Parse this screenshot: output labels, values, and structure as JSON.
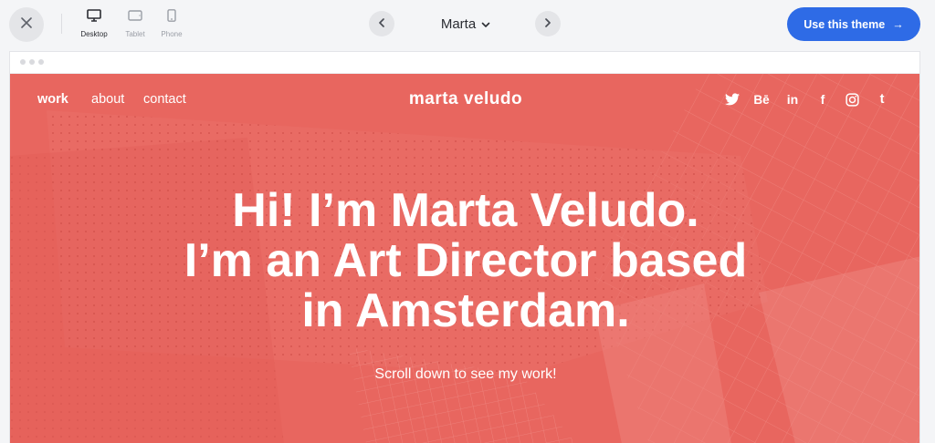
{
  "toolbar": {
    "close_icon": "close-icon",
    "devices": [
      {
        "label": "Desktop",
        "icon": "desktop-icon",
        "active": true
      },
      {
        "label": "Tablet",
        "icon": "tablet-icon",
        "active": false
      },
      {
        "label": "Phone",
        "icon": "phone-icon",
        "active": false
      }
    ],
    "theme_name": "Marta",
    "prev_icon": "chevron-left-icon",
    "next_icon": "chevron-right-icon",
    "use_theme_label": "Use this theme",
    "use_theme_arrow": "→",
    "accent_color": "#2e6be6"
  },
  "site": {
    "background_color": "#e8665f",
    "nav": [
      {
        "label": "work"
      },
      {
        "label": "about"
      },
      {
        "label": "contact"
      }
    ],
    "logo": "marta veludo",
    "social_icons": [
      "twitter-icon",
      "behance-icon",
      "linkedin-icon",
      "facebook-icon",
      "instagram-icon",
      "tumblr-icon"
    ],
    "social_glyphs": {
      "behance": "Bē",
      "linkedin": "in",
      "facebook": "f",
      "tumblr": "t"
    },
    "hero_lines": [
      "Hi! I’m Marta Veludo.",
      "I’m an Art Director based",
      "in Amsterdam."
    ],
    "hero_subtitle": "Scroll down to see my work!"
  }
}
